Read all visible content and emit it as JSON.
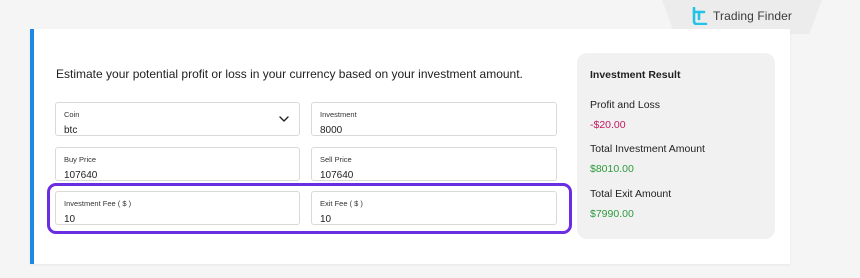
{
  "brand": {
    "name": "Trading Finder",
    "icon": "trading-finder-logo-icon"
  },
  "calculator": {
    "intro": "Estimate your potential profit or loss in your currency based on your investment amount.",
    "coin": {
      "label": "Coin",
      "value": "btc",
      "icon": "chevron-down-icon"
    },
    "investment": {
      "label": "Investment",
      "value": "8000"
    },
    "buy_price": {
      "label": "Buy Price",
      "value": "107640"
    },
    "sell_price": {
      "label": "Sell Price",
      "value": "107640"
    },
    "investment_fee": {
      "label": "Investment Fee ( $ )",
      "value": "10"
    },
    "exit_fee": {
      "label": "Exit Fee ( $ )",
      "value": "10"
    }
  },
  "result": {
    "title": "Investment Result",
    "profit_loss": {
      "label": "Profit and Loss",
      "value": "-$20.00"
    },
    "total_investment": {
      "label": "Total Investment Amount",
      "value": "$8010.00"
    },
    "total_exit": {
      "label": "Total Exit Amount",
      "value": "$7990.00"
    }
  },
  "colors": {
    "accent": "#1e88e5",
    "highlight": "#6a2de1",
    "negative": "#c2185b",
    "positive": "#2e9a3e",
    "logo": "#22c3e6"
  }
}
